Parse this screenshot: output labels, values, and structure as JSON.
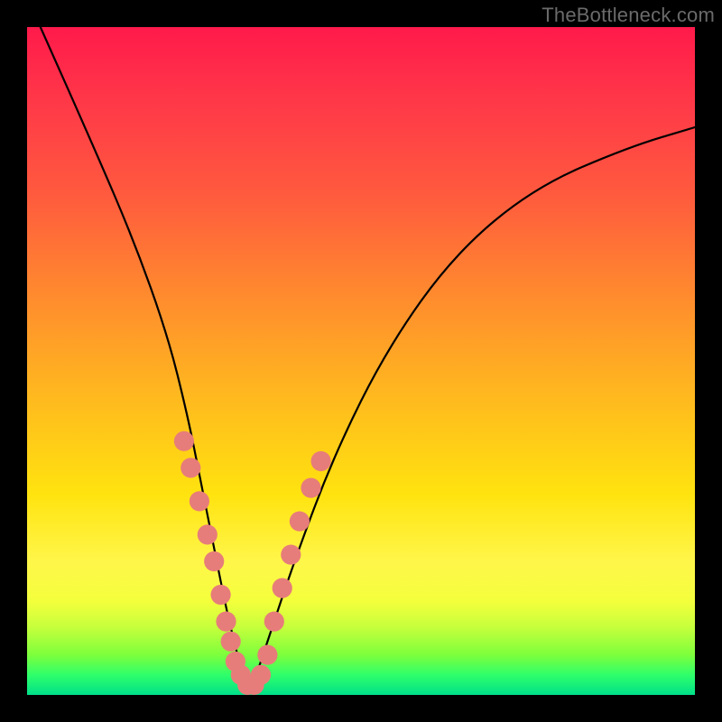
{
  "watermark": "TheBottleneck.com",
  "chart_data": {
    "type": "line",
    "title": "",
    "xlabel": "",
    "ylabel": "",
    "xlim": [
      0,
      100
    ],
    "ylim": [
      0,
      100
    ],
    "grid": false,
    "legend": false,
    "series": [
      {
        "name": "curve",
        "path_type": "v-shape",
        "x": [
          2,
          10,
          16,
          21,
          24,
          26,
          28,
          30,
          32,
          33,
          34,
          36,
          40,
          46,
          54,
          64,
          76,
          90,
          100
        ],
        "y": [
          100,
          82,
          68,
          54,
          42,
          32,
          22,
          12,
          4,
          0,
          2,
          8,
          20,
          36,
          52,
          66,
          76,
          82,
          85
        ]
      }
    ],
    "dots": {
      "name": "marker-dots",
      "points": [
        {
          "x": 23.5,
          "y": 38
        },
        {
          "x": 24.5,
          "y": 34
        },
        {
          "x": 25.8,
          "y": 29
        },
        {
          "x": 27.0,
          "y": 24
        },
        {
          "x": 28.0,
          "y": 20
        },
        {
          "x": 29.0,
          "y": 15
        },
        {
          "x": 29.8,
          "y": 11
        },
        {
          "x": 30.5,
          "y": 8
        },
        {
          "x": 31.2,
          "y": 5
        },
        {
          "x": 32.0,
          "y": 3
        },
        {
          "x": 33.0,
          "y": 1.5
        },
        {
          "x": 34.0,
          "y": 1.5
        },
        {
          "x": 35.0,
          "y": 3
        },
        {
          "x": 36.0,
          "y": 6
        },
        {
          "x": 37.0,
          "y": 11
        },
        {
          "x": 38.2,
          "y": 16
        },
        {
          "x": 39.5,
          "y": 21
        },
        {
          "x": 40.8,
          "y": 26
        },
        {
          "x": 42.5,
          "y": 31
        },
        {
          "x": 44.0,
          "y": 35
        }
      ],
      "radius": 8
    },
    "gradient_stops": [
      {
        "pos": 0,
        "color": "#ff1a4b"
      },
      {
        "pos": 25,
        "color": "#ff5a3e"
      },
      {
        "pos": 55,
        "color": "#ffb81f"
      },
      {
        "pos": 80,
        "color": "#fff64a"
      },
      {
        "pos": 94,
        "color": "#7dff3c"
      },
      {
        "pos": 100,
        "color": "#00e08a"
      }
    ]
  }
}
